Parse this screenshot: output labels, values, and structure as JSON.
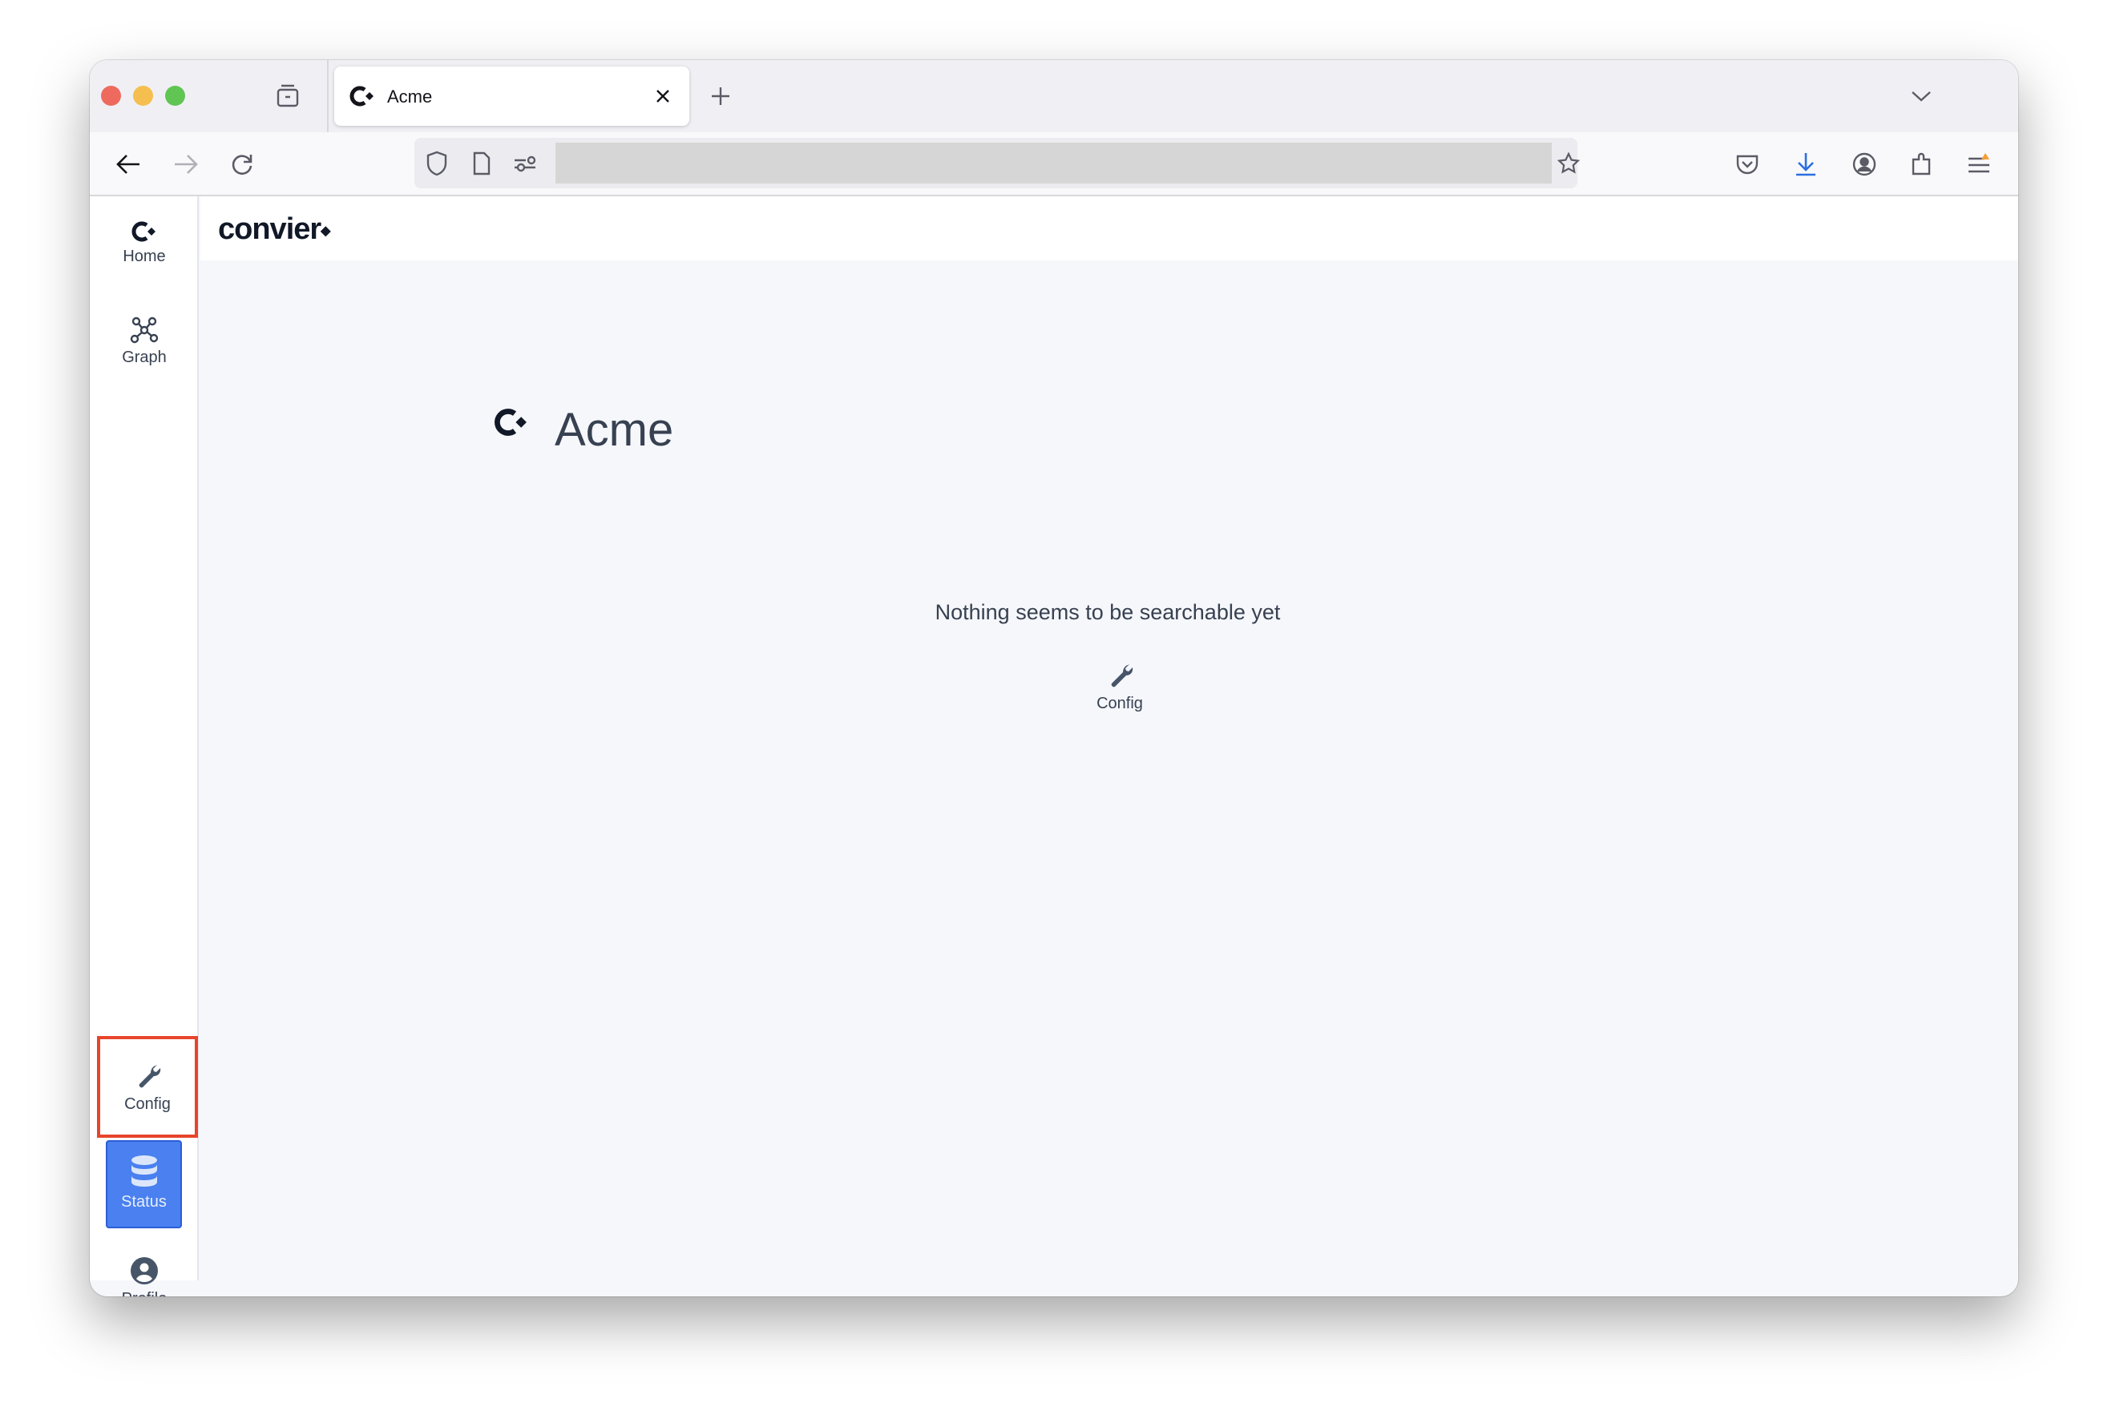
{
  "browser": {
    "tab": {
      "title": "Acme",
      "favicon": "convier-icon"
    },
    "traffic_lights": {
      "close": "#ee6a5e",
      "minimize": "#f5bf4f",
      "maximize": "#61c554"
    },
    "icons": [
      "tab-groups-icon",
      "close-icon",
      "new-tab-plus-icon",
      "tab-list-chevron-icon",
      "back-arrow-icon",
      "forward-arrow-icon",
      "reload-icon",
      "shield-icon",
      "page-icon",
      "permissions-icon",
      "bookmark-star-icon",
      "pocket-icon",
      "download-icon",
      "account-icon",
      "extensions-icon",
      "menu-icon"
    ],
    "url": ""
  },
  "app": {
    "logo": "convier",
    "sidebar": {
      "items": [
        {
          "label": "Home",
          "icon": "convier-icon"
        },
        {
          "label": "Graph",
          "icon": "graph-icon"
        },
        {
          "label": "Config",
          "icon": "wrench-icon",
          "highlighted": true
        },
        {
          "label": "Status",
          "icon": "database-icon",
          "active": true
        },
        {
          "label": "Profile",
          "icon": "user-circle-icon"
        }
      ]
    },
    "main": {
      "title": "Acme",
      "empty_message": "Nothing seems to be searchable yet",
      "config_link": "Config"
    },
    "colors": {
      "accent": "#4a80ef",
      "highlight_border": "#e8442c",
      "text": "#374151",
      "background": "#f6f7fb"
    }
  }
}
